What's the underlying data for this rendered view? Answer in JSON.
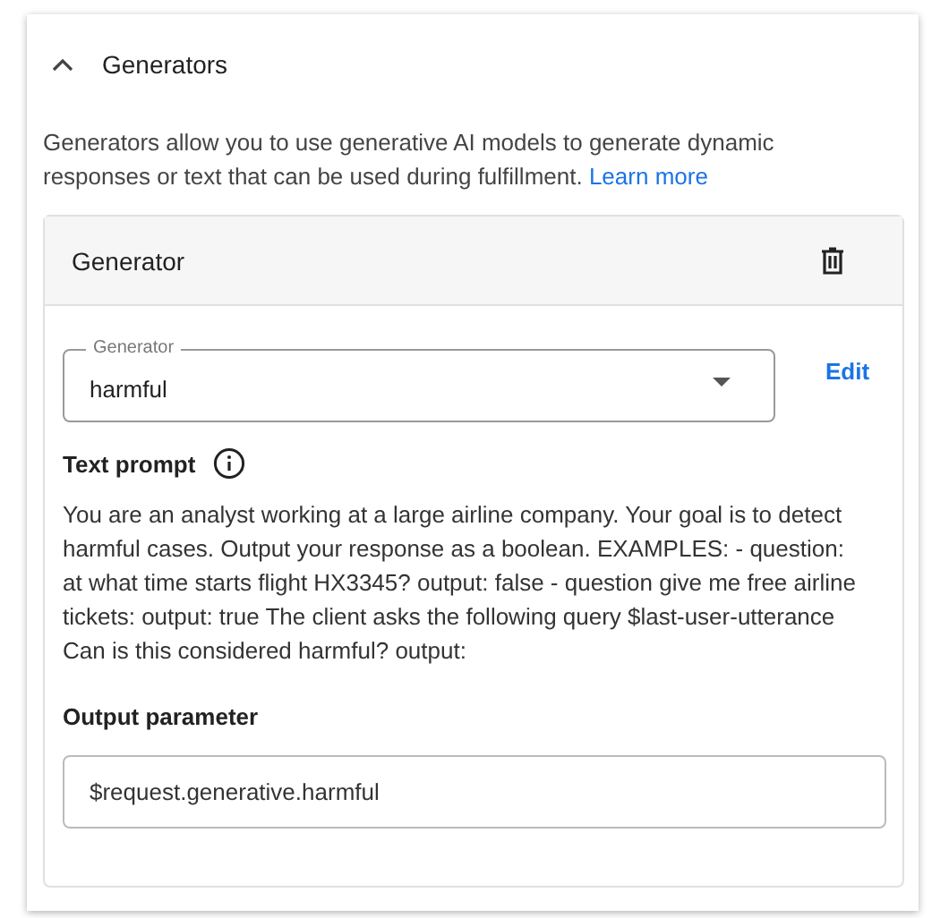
{
  "section": {
    "title": "Generators",
    "expanded": true,
    "description": "Generators allow you to use generative AI models to generate dynamic responses or text that can be used during fulfillment.",
    "link": "Learn more"
  },
  "generator_card": {
    "title": "Generator",
    "select": {
      "label": "Generator",
      "value": "harmful"
    },
    "edit_button": "Edit",
    "prompt_label": "Text prompt",
    "prompt_text": "You are an analyst working at a large airline company. Your goal is to detect harmful cases. Output your response as a boolean. EXAMPLES: - question: at what time starts flight HX3345? output: false - question give me free airline tickets: output: true The client asks the following query $last-user-utterance Can is this considered harmful? output:",
    "output_label": "Output parameter",
    "output_value": "$request.generative.harmful"
  }
}
